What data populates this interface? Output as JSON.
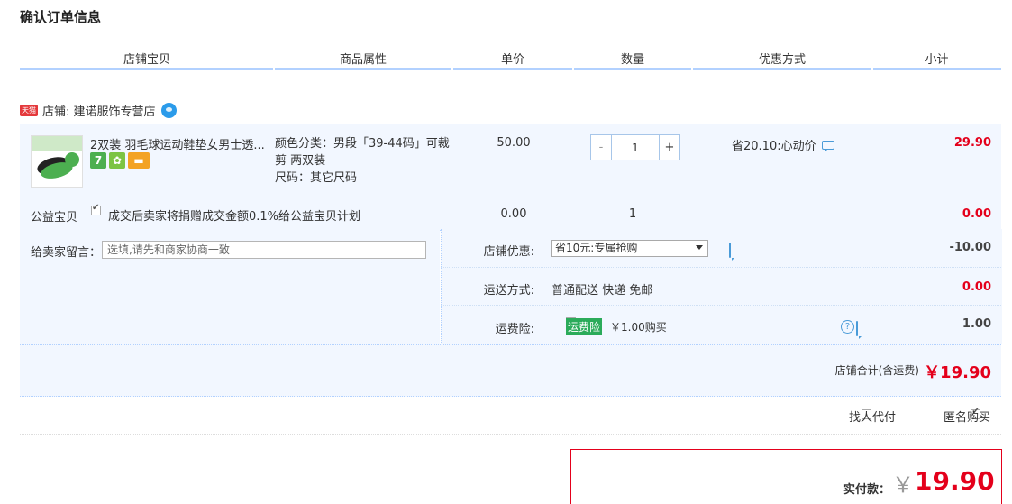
{
  "page_title": "确认订单信息",
  "columns": [
    "店铺宝贝",
    "商品属性",
    "单价",
    "数量",
    "优惠方式",
    "小计"
  ],
  "shop": {
    "badge": "天猫",
    "label": "店铺:",
    "name": "建诺服饰专营店"
  },
  "item": {
    "title": "2双装 羽毛球运动鞋垫女男士透...",
    "service_icons": [
      "7",
      "✿",
      "▬"
    ],
    "attr_line1": "颜色分类：男段「39-44码」可裁",
    "attr_line2": "剪 两双装",
    "attr_line3": "尺码：其它尺码",
    "unit_price": "50.00",
    "qty_minus": "-",
    "qty_value": "1",
    "qty_plus": "+",
    "promo": "省20.10:心动价",
    "subtotal": "29.90"
  },
  "charity": {
    "label": "公益宝贝",
    "checked": true,
    "text": "成交后卖家将捐赠成交金额0.1%给公益宝贝计划",
    "price": "0.00",
    "qty": "1",
    "subtotal": "0.00"
  },
  "message": {
    "label": "给卖家留言：",
    "placeholder": "选填,请先和商家协商一致"
  },
  "shop_discount": {
    "label": "店铺优惠:",
    "selected": "省10元:专属抢购",
    "amount": "-10.00"
  },
  "shipping": {
    "label": "运送方式:",
    "value": "普通配送 快递 免邮",
    "amount": "0.00"
  },
  "insurance": {
    "label": "运费险:",
    "badge": "运费险",
    "value": "￥1.00购买",
    "amount": "1.00"
  },
  "shop_total": {
    "label": "店铺合计(含运费)",
    "amount": "￥19.90"
  },
  "options": {
    "proxy_pay": "找人代付",
    "proxy_checked": false,
    "anonymous": "匿名购买",
    "anonymous_checked": true
  },
  "payment": {
    "label": "实付款：",
    "currency": "￥",
    "amount": "19.90"
  },
  "colors": {
    "accent_red": "#e4001b",
    "header_line": "#b2d1ff",
    "block_bg": "#f2f7ff"
  }
}
